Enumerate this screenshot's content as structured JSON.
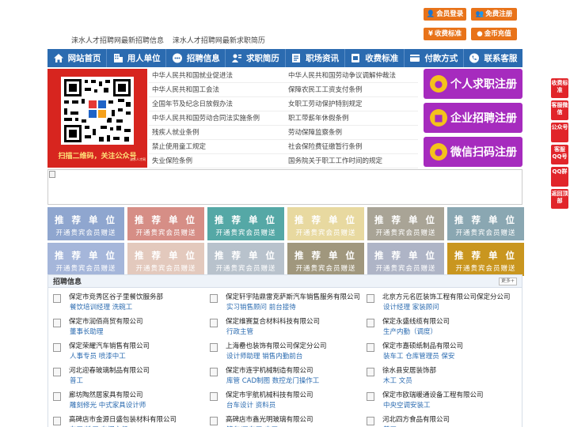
{
  "header": {
    "links": [
      "涞水人才招聘网最新招聘信息",
      "涞水人才招聘网最新求职简历"
    ],
    "buttons": [
      {
        "label": "会员登录",
        "icon": "user-icon"
      },
      {
        "label": "免费注册",
        "icon": "users-icon"
      },
      {
        "label": "收费标准",
        "icon": "yen-icon"
      },
      {
        "label": "金币充值",
        "icon": "coin-icon"
      }
    ]
  },
  "nav": [
    {
      "label": "网站首页",
      "icon": "home-icon"
    },
    {
      "label": "用人单位",
      "icon": "building-icon"
    },
    {
      "label": "招聘信息",
      "icon": "chat-icon"
    },
    {
      "label": "求职简历",
      "icon": "resume-icon"
    },
    {
      "label": "职场资讯",
      "icon": "news-icon"
    },
    {
      "label": "收费标准",
      "icon": "fee-icon"
    },
    {
      "label": "付款方式",
      "icon": "wallet-icon"
    },
    {
      "label": "联系客服",
      "icon": "phone-icon"
    }
  ],
  "qr": {
    "caption": "扫描二维码，关注公众号",
    "mini": "涞水人才网"
  },
  "laws": [
    [
      "中华人民共和国就业促进法",
      "中华人民共和国劳动争议调解仲裁法"
    ],
    [
      "中华人民共和国工会法",
      "保障农民工工资支付条例"
    ],
    [
      "全国年节及纪念日放假办法",
      "女职工劳动保护特别规定"
    ],
    [
      "中华人民共和国劳动合同法实施条例",
      "职工带薪年休假条例"
    ],
    [
      "残疾人就业条例",
      "劳动保障监察条例"
    ],
    [
      "禁止使用童工规定",
      "社会保险费征缴暂行条例"
    ],
    [
      "失业保险条例",
      "国务院关于职工工作时间的规定"
    ]
  ],
  "register": [
    {
      "label": "个人求职注册",
      "icon": "person-icon"
    },
    {
      "label": "企业招聘注册",
      "icon": "company-icon"
    },
    {
      "label": "微信扫码注册",
      "icon": "wechat-icon"
    }
  ],
  "float": [
    {
      "label": "收费标准"
    },
    {
      "label": "客服微信"
    },
    {
      "label": "公众号"
    },
    {
      "label": "客服QQ号"
    },
    {
      "label": "QQ群"
    },
    {
      "label": "返回顶部"
    }
  ],
  "recommend": {
    "title": "推 荐 单 位",
    "subtitle": "开通贵宾会员赠送",
    "colors": [
      "#8fa6cf",
      "#d68e86",
      "#55a8a6",
      "#e8d9a0",
      "#a9a496",
      "#8aa7b2",
      "#a5b6da",
      "#e3c9bd",
      "#b8c2cc",
      "#a0977d",
      "#aeb4c6",
      "#c9961f"
    ]
  },
  "recruit": {
    "title": "招聘信息",
    "more": "更多+",
    "jobs": [
      {
        "company": "保定市竞秀区谷子里餐饮服务部",
        "positions": "餐饮培训经理 洗碗工"
      },
      {
        "company": "保定轩宇陆鼎雷克萨斯汽车销售服务有限公司",
        "positions": "实习销售顾问 前台接待"
      },
      {
        "company": "北京方元名匠装饰工程有限公司保定分公司",
        "positions": "设计经理 家装顾问"
      },
      {
        "company": "保定市润佰商贸有限公司",
        "positions": "董事长助理"
      },
      {
        "company": "保定维赛复合材料科技有限公司",
        "positions": "行政主管"
      },
      {
        "company": "保定永盛线缆有限公司",
        "positions": "生产内勤（调度）"
      },
      {
        "company": "保定荣耀汽车销售有限公司",
        "positions": "人事专员 喷漆中工"
      },
      {
        "company": "上海罍也装饰有限公司保定分公司",
        "positions": "设计师助理 销售内勤前台"
      },
      {
        "company": "保定市嘉硕纸制品有限公司",
        "positions": "装车工 仓库管理员 保安"
      },
      {
        "company": "河北迎春玻璃制品有限公司",
        "positions": "普工"
      },
      {
        "company": "保定市连宇机械制造有限公司",
        "positions": "库管 CAD制图 数控龙门操作工"
      },
      {
        "company": "徐水县安居装饰部",
        "positions": "木工 文员"
      },
      {
        "company": "廊坊陶然居家具有限公司",
        "positions": "雕刻修光 中式家具设计师"
      },
      {
        "company": "保定市宇航机械科技有限公司",
        "positions": "台车设计 资料员"
      },
      {
        "company": "保定市欧瑞暖通设备工程有限公司",
        "positions": "中央空调安装工"
      },
      {
        "company": "高碑店市金源日盛包装材料有限公司",
        "positions": "车工/铣工 车间主任"
      },
      {
        "company": "高碑店市鑫光明玻璃有限公司",
        "positions": "铲车/叉车工 电工"
      },
      {
        "company": "河北四方食品有限公司",
        "positions": "普工"
      }
    ]
  }
}
